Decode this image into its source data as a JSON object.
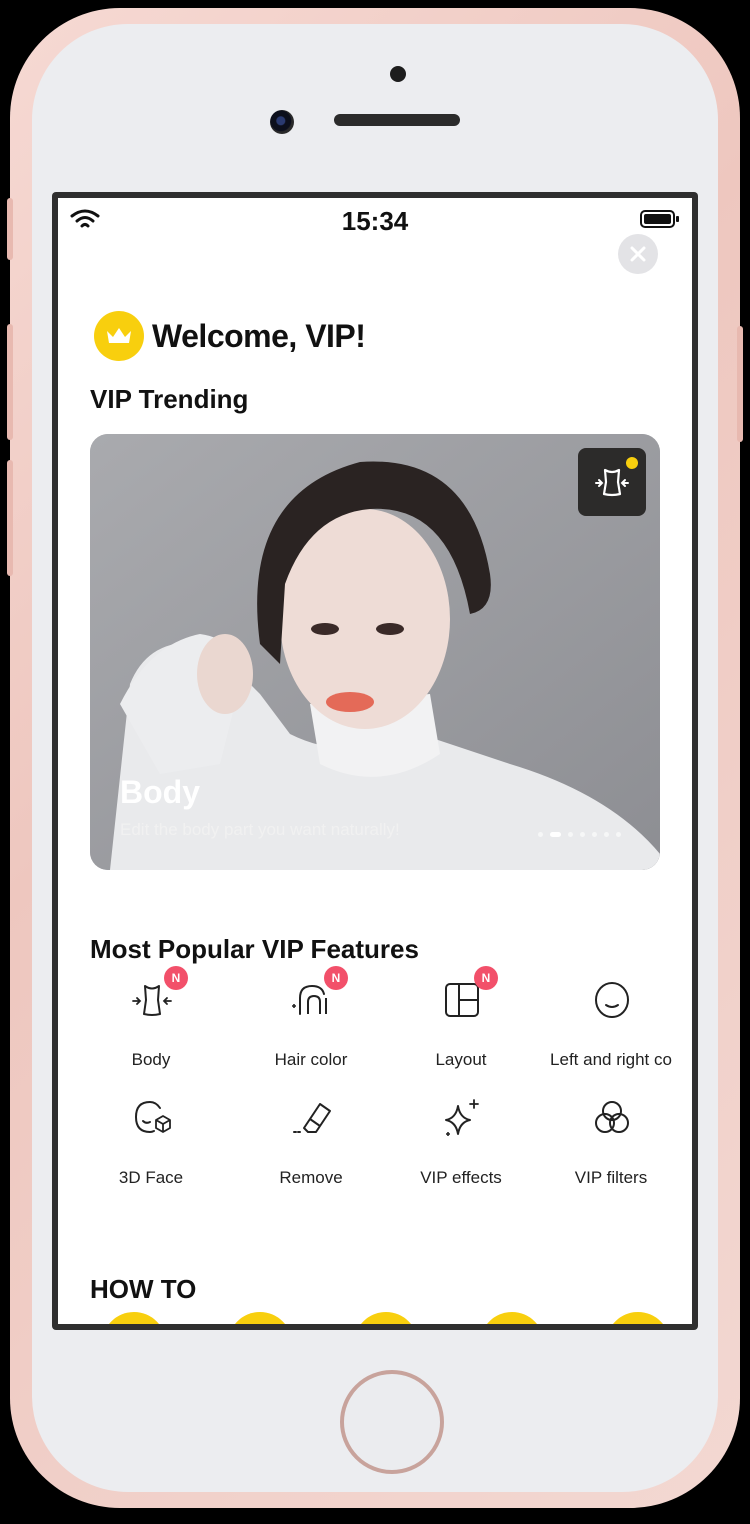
{
  "status_bar": {
    "time": "15:34"
  },
  "header": {
    "title": "Welcome, VIP!"
  },
  "trending": {
    "section_title": "VIP Trending",
    "banner": {
      "title": "Body",
      "subtitle": "Edit the body part you want naturally!",
      "page_count": 7,
      "active_page": 2
    }
  },
  "popular": {
    "section_title": "Most Popular VIP Features",
    "badge_label": "N",
    "items": [
      {
        "label": "Body",
        "icon": "body-reshape-icon",
        "is_new": true
      },
      {
        "label": "Hair color",
        "icon": "hair-color-icon",
        "is_new": true
      },
      {
        "label": "Layout",
        "icon": "layout-icon",
        "is_new": true
      },
      {
        "label": "Left and right co",
        "icon": "face-outline-icon",
        "is_new": false
      },
      {
        "label": "3D Face",
        "icon": "3d-face-icon",
        "is_new": false
      },
      {
        "label": "Remove",
        "icon": "eraser-icon",
        "is_new": false
      },
      {
        "label": "VIP effects",
        "icon": "sparkles-icon",
        "is_new": false
      },
      {
        "label": "VIP filters",
        "icon": "filters-icon",
        "is_new": false
      }
    ]
  },
  "howto": {
    "section_title": "HOW TO"
  },
  "colors": {
    "accent_yellow": "#f8cf0e",
    "new_badge": "#f2506a",
    "text_primary": "#111111"
  }
}
